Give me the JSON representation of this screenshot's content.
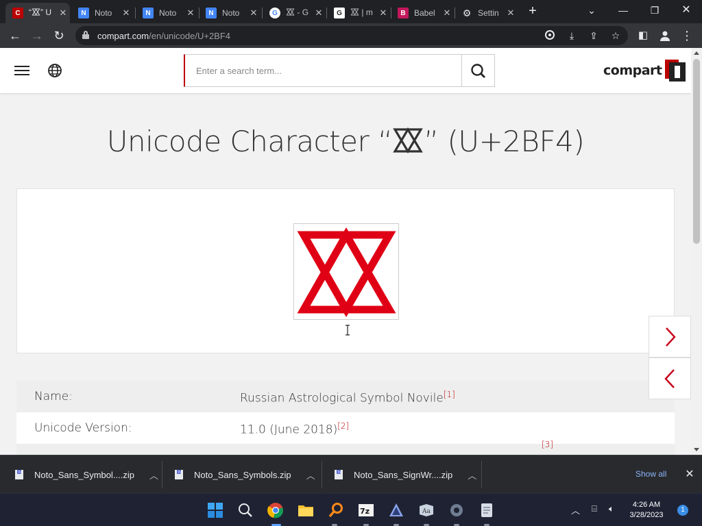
{
  "browser": {
    "tabs": [
      {
        "title": "“⯴” U",
        "active": true
      },
      {
        "title": "Noto",
        "active": false
      },
      {
        "title": "Noto",
        "active": false
      },
      {
        "title": "Noto",
        "active": false
      },
      {
        "title": "⯴ - G",
        "active": false
      },
      {
        "title": "⯴ | m",
        "active": false
      },
      {
        "title": "Babel",
        "active": false
      },
      {
        "title": "Settin",
        "active": false
      }
    ],
    "url_host": "compart.com",
    "url_path": "/en/unicode/U+2BF4"
  },
  "site": {
    "search_placeholder": "Enter a search term...",
    "logo_text": "compart",
    "heading_prefix": "Unicode Character “",
    "heading_suffix": "” (U+2BF4)",
    "glyph_color": "#e00015",
    "accent_color": "#b00000",
    "properties": [
      {
        "key": "Name:",
        "value": "Russian Astrological Symbol Novile",
        "ref": "[1]"
      },
      {
        "key": "Unicode Version:",
        "value": "11.0 (June 2018)",
        "ref": "[2]"
      },
      {
        "key": "",
        "value": "",
        "ref": "[3]"
      }
    ]
  },
  "downloads": {
    "items": [
      {
        "name": "Noto_Sans_Symbol....zip"
      },
      {
        "name": "Noto_Sans_Symbols.zip"
      },
      {
        "name": "Noto_Sans_SignWr....zip"
      }
    ],
    "show_all": "Show all"
  },
  "taskbar": {
    "time": "4:26 AM",
    "date": "3/28/2023",
    "notification_count": "1"
  }
}
